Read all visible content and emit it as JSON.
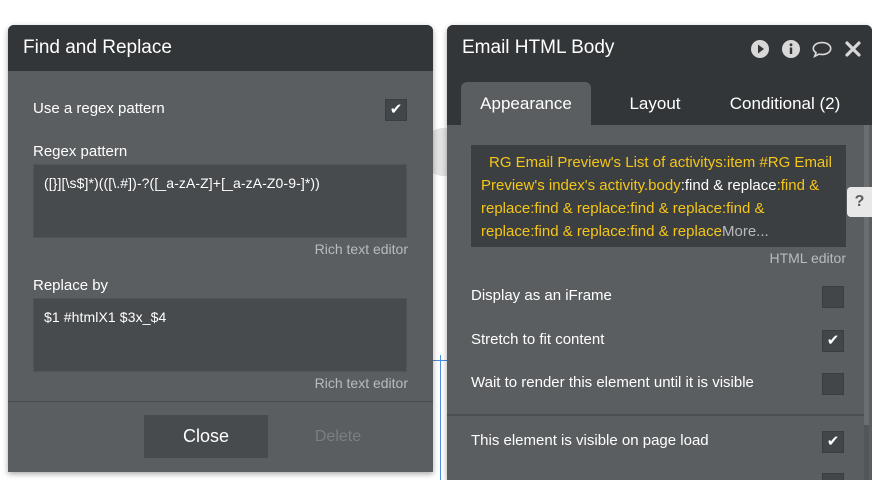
{
  "find_replace": {
    "title": "Find and Replace",
    "use_regex_label": "Use a regex pattern",
    "use_regex_checked": true,
    "regex_label": "Regex pattern",
    "regex_value": "([}][\\s$]*)(([\\.#])-?([_a-zA-Z]+[_a-zA-Z0-9-]*))",
    "regex_editor_label": "Rich text editor",
    "replace_label": "Replace by",
    "replace_value": "$1 #htmlX1 $3x_$4",
    "replace_editor_label": "Rich text editor",
    "close_label": "Close",
    "delete_label": "Delete"
  },
  "email_panel": {
    "title": "Email HTML Body",
    "icons": [
      "play-icon",
      "info-icon",
      "comment-icon",
      "close-icon"
    ],
    "tabs": [
      {
        "label": "Appearance",
        "active": true
      },
      {
        "label": "Layout",
        "active": false
      },
      {
        "label": "Conditional (2)",
        "active": false
      }
    ],
    "expression": {
      "part1": "RG Email Preview's List of activitys:item #RG Email Preview's index's activity.body",
      "part2": ":find & replace",
      "part3": ":find & replace:find & replace:find & replace:find & replace:find & replace:find & replace",
      "more": "More..."
    },
    "html_editor_label": "HTML editor",
    "help_label": "?",
    "options": [
      {
        "label": "Display as an iFrame",
        "checked": false
      },
      {
        "label": "Stretch to fit content",
        "checked": true
      },
      {
        "label": "Wait to render this element until it is visible",
        "checked": false
      },
      {
        "label": "This element is visible on page load",
        "checked": true
      }
    ]
  },
  "colors": {
    "panel_bg": "#5a5e60",
    "header_bg": "#323638",
    "expression_gold": "#f5c518",
    "input_bg": "#474b4e"
  }
}
